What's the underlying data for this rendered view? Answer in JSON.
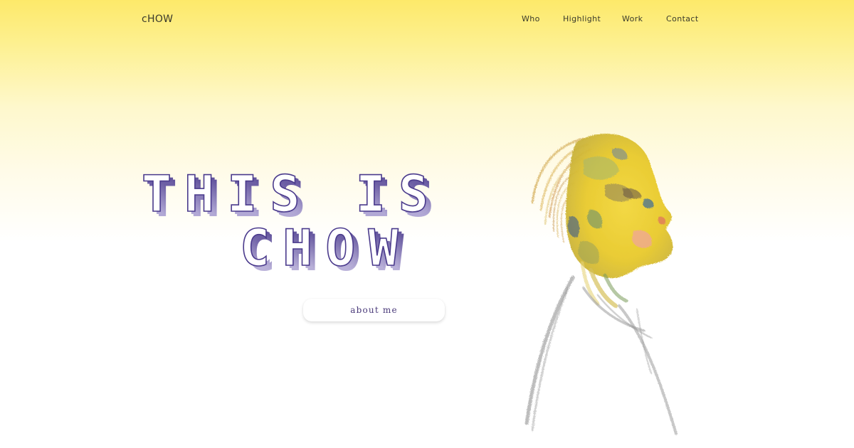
{
  "brand": {
    "logo_text": "cHOW"
  },
  "nav": {
    "items": [
      {
        "label": "Who"
      },
      {
        "label": "Highlight"
      },
      {
        "label": "Work"
      },
      {
        "label": "Contact"
      }
    ]
  },
  "hero": {
    "title_line1": "THIS IS",
    "title_line2": "CHOW",
    "button_label": "about me"
  },
  "colors": {
    "background_top": "#fde96a",
    "background_bottom": "#ffffff",
    "title_shadow": "#5a4a96",
    "button_text": "#4a3a7a"
  },
  "icons": {
    "portrait": "painted-portrait-illustration"
  }
}
